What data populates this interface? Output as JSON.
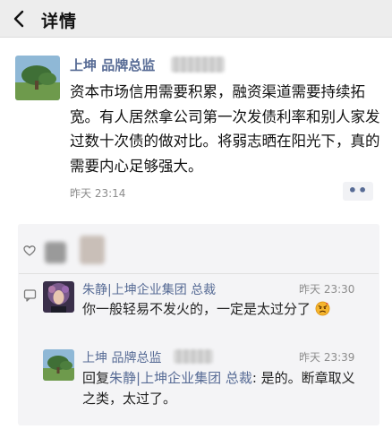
{
  "nav": {
    "title": "详情",
    "back_icon": "chevron-left-icon"
  },
  "post": {
    "author": "上坤 品牌总监",
    "text": "资本市场信用需要积累，融资渠道需要持续拓宽。有人居然拿公司第一次发债利率和别人家发过数十次债的做对比。将弱志晒在阳光下，真的需要内心足够强大。",
    "time": "昨天 23:14",
    "more_label": "••"
  },
  "comments": [
    {
      "author": "朱静|上坤企业集团 总裁",
      "time": "昨天 23:30",
      "text": "你一般轻易不发火的，一定是太过分了",
      "emoji": "angry-face"
    },
    {
      "author": "上坤 品牌总监",
      "time": "昨天 23:39",
      "reply_prefix": "回复",
      "reply_to": "朱静|上坤企业集团 总裁",
      "text": ": 是的。断章取义之类，太过了。"
    }
  ],
  "colors": {
    "link": "#576b95",
    "nav_bg": "#ededed",
    "panel_bg": "#f4f4f6"
  }
}
